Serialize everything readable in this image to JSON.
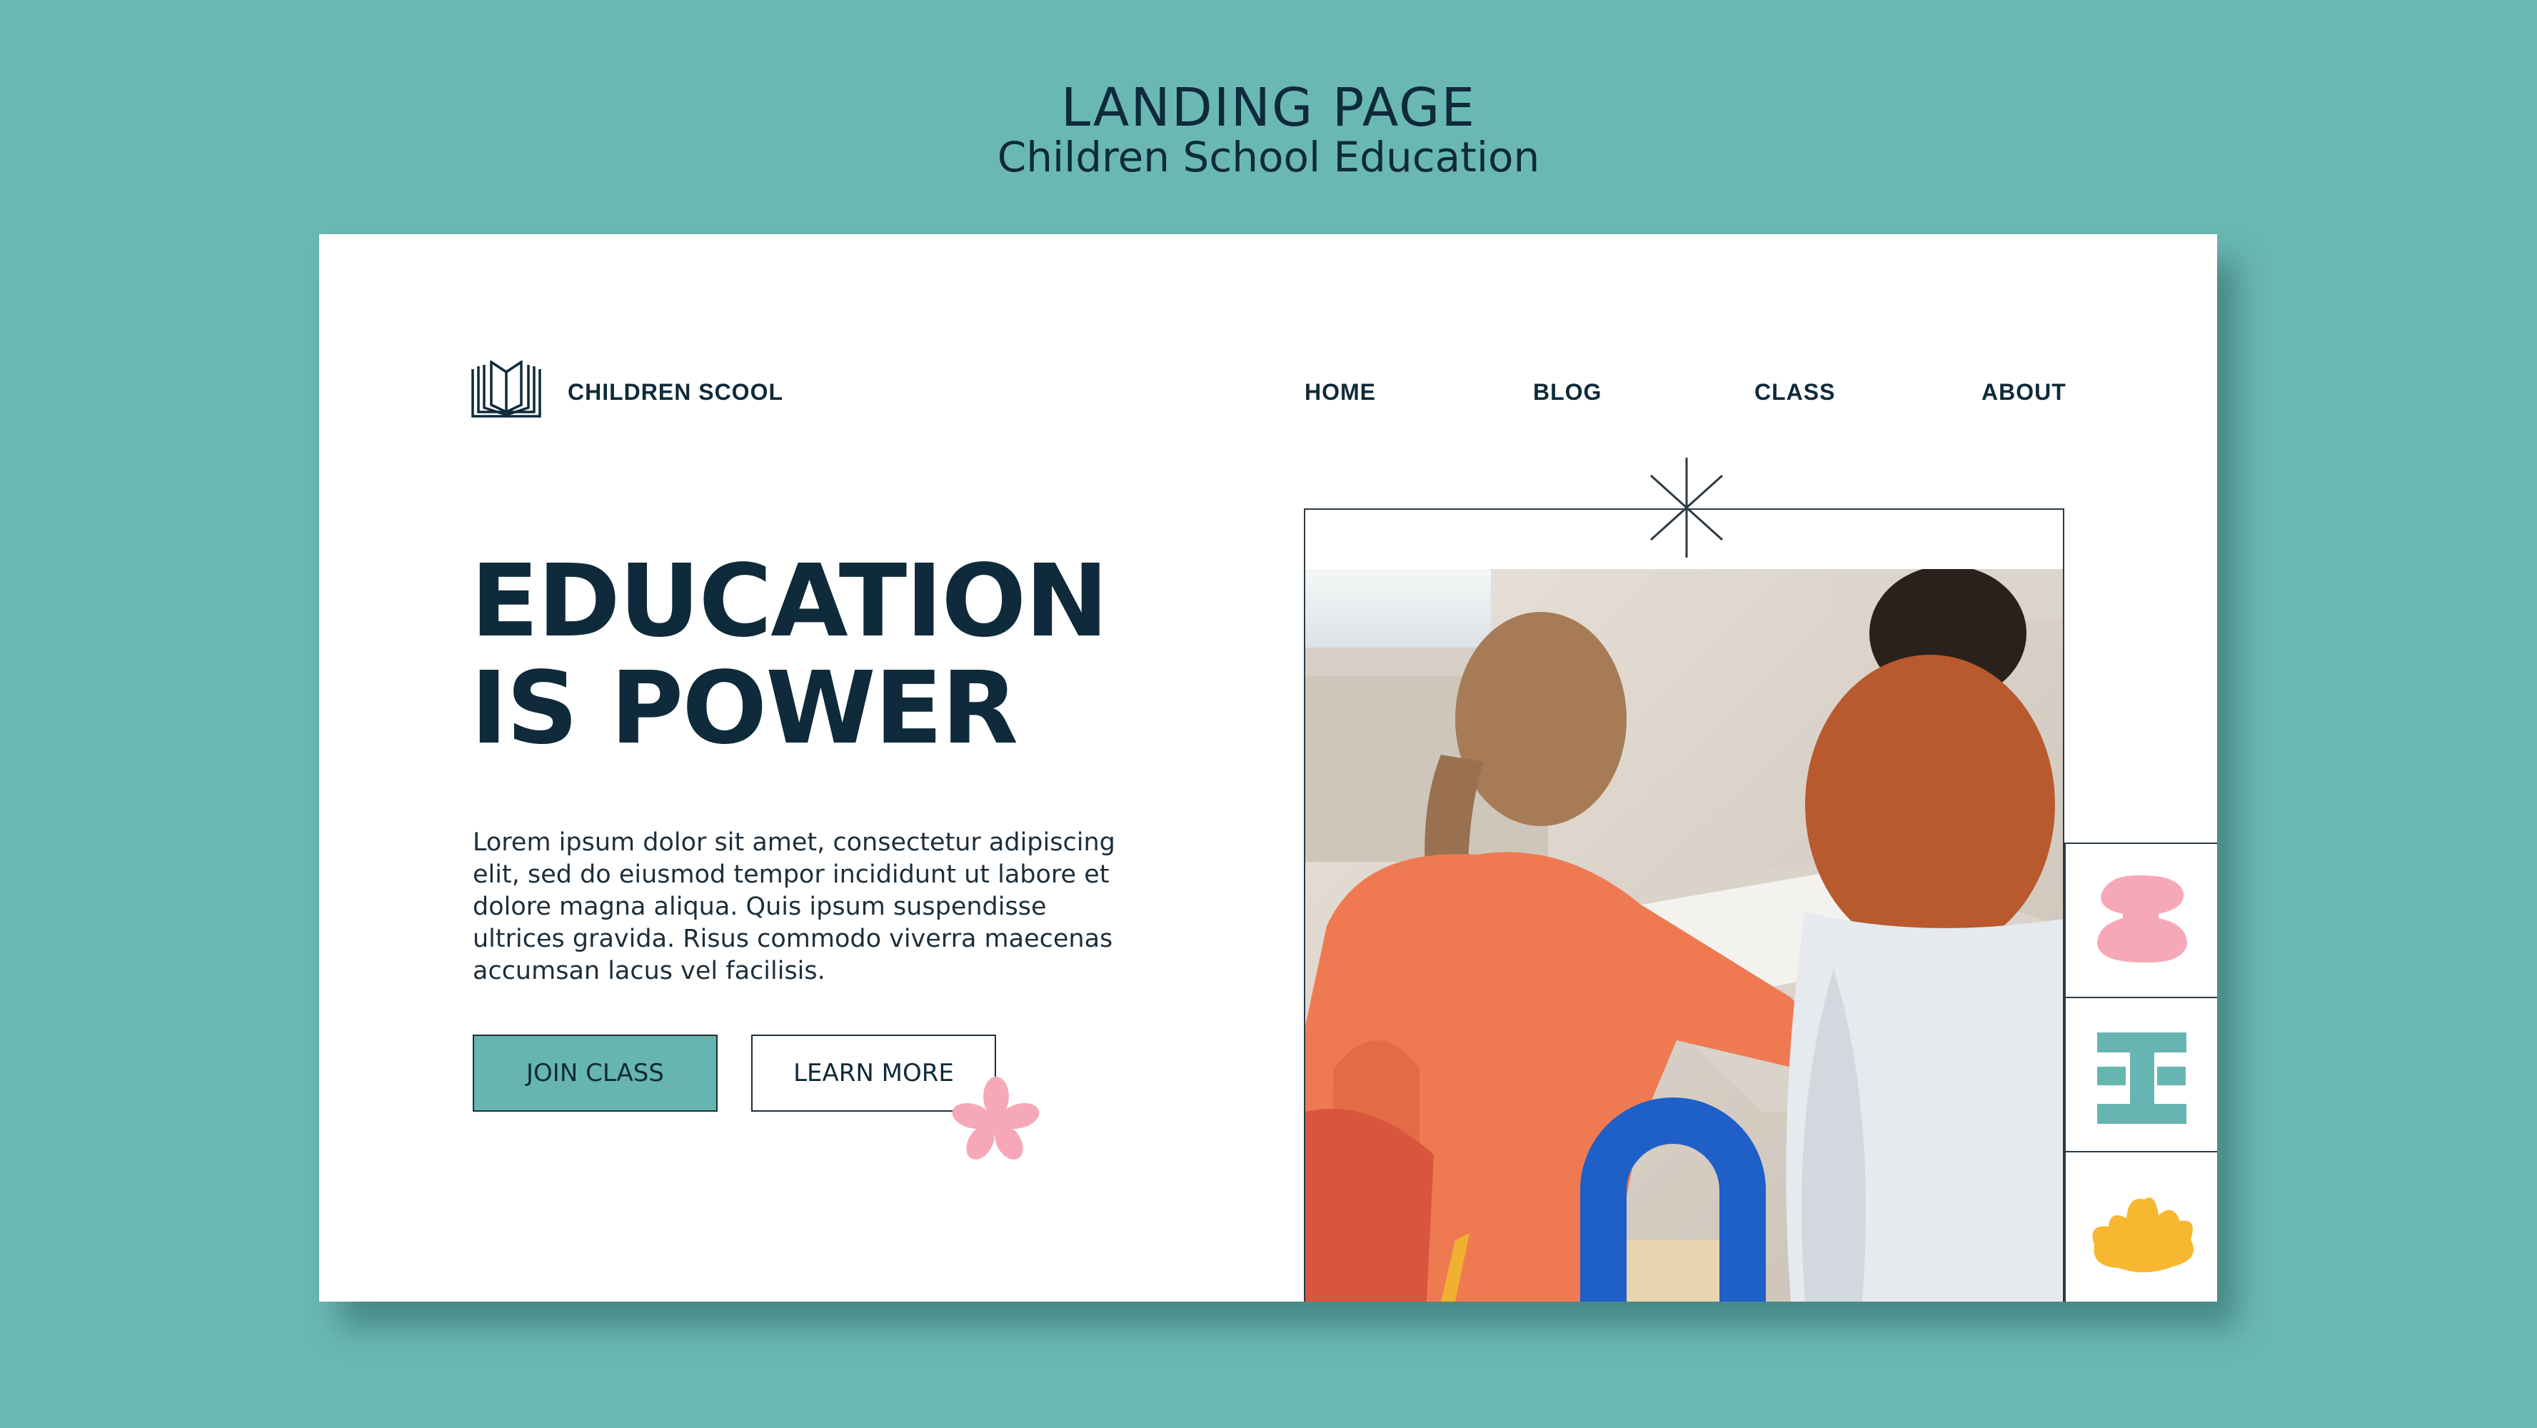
{
  "header": {
    "title": "LANDING PAGE",
    "subtitle": "Children School Education"
  },
  "brand": {
    "name": "CHILDREN SCOOL",
    "icon": "open-book-icon"
  },
  "nav": {
    "items": [
      "HOME",
      "BLOG",
      "CLASS",
      "ABOUT"
    ]
  },
  "hero": {
    "headline_line1": "EDUCATION",
    "headline_line2": "IS POWER",
    "body": "Lorem ipsum dolor sit amet, consectetur adipiscing elit, sed do eiusmod tempor incididunt ut labore et dolore magna aliqua. Quis ipsum suspendisse ultrices gravida. Risus commodo viverra maecenas accumsan lacus vel facilisis.",
    "primary_button": "JOIN CLASS",
    "secondary_button": "LEARN MORE"
  },
  "colors": {
    "background": "#6ab8b4",
    "accent_teal": "#66b5b0",
    "text_dark": "#0f2a3a",
    "pink": "#f7a8b8",
    "yellow": "#f7b731",
    "blue": "#1e5fc8"
  },
  "decorations": [
    "pink-flower-icon",
    "sparkle-icon",
    "pink-blob-icon",
    "teal-glyph-icon",
    "yellow-splat-icon",
    "blue-arch-icon"
  ]
}
